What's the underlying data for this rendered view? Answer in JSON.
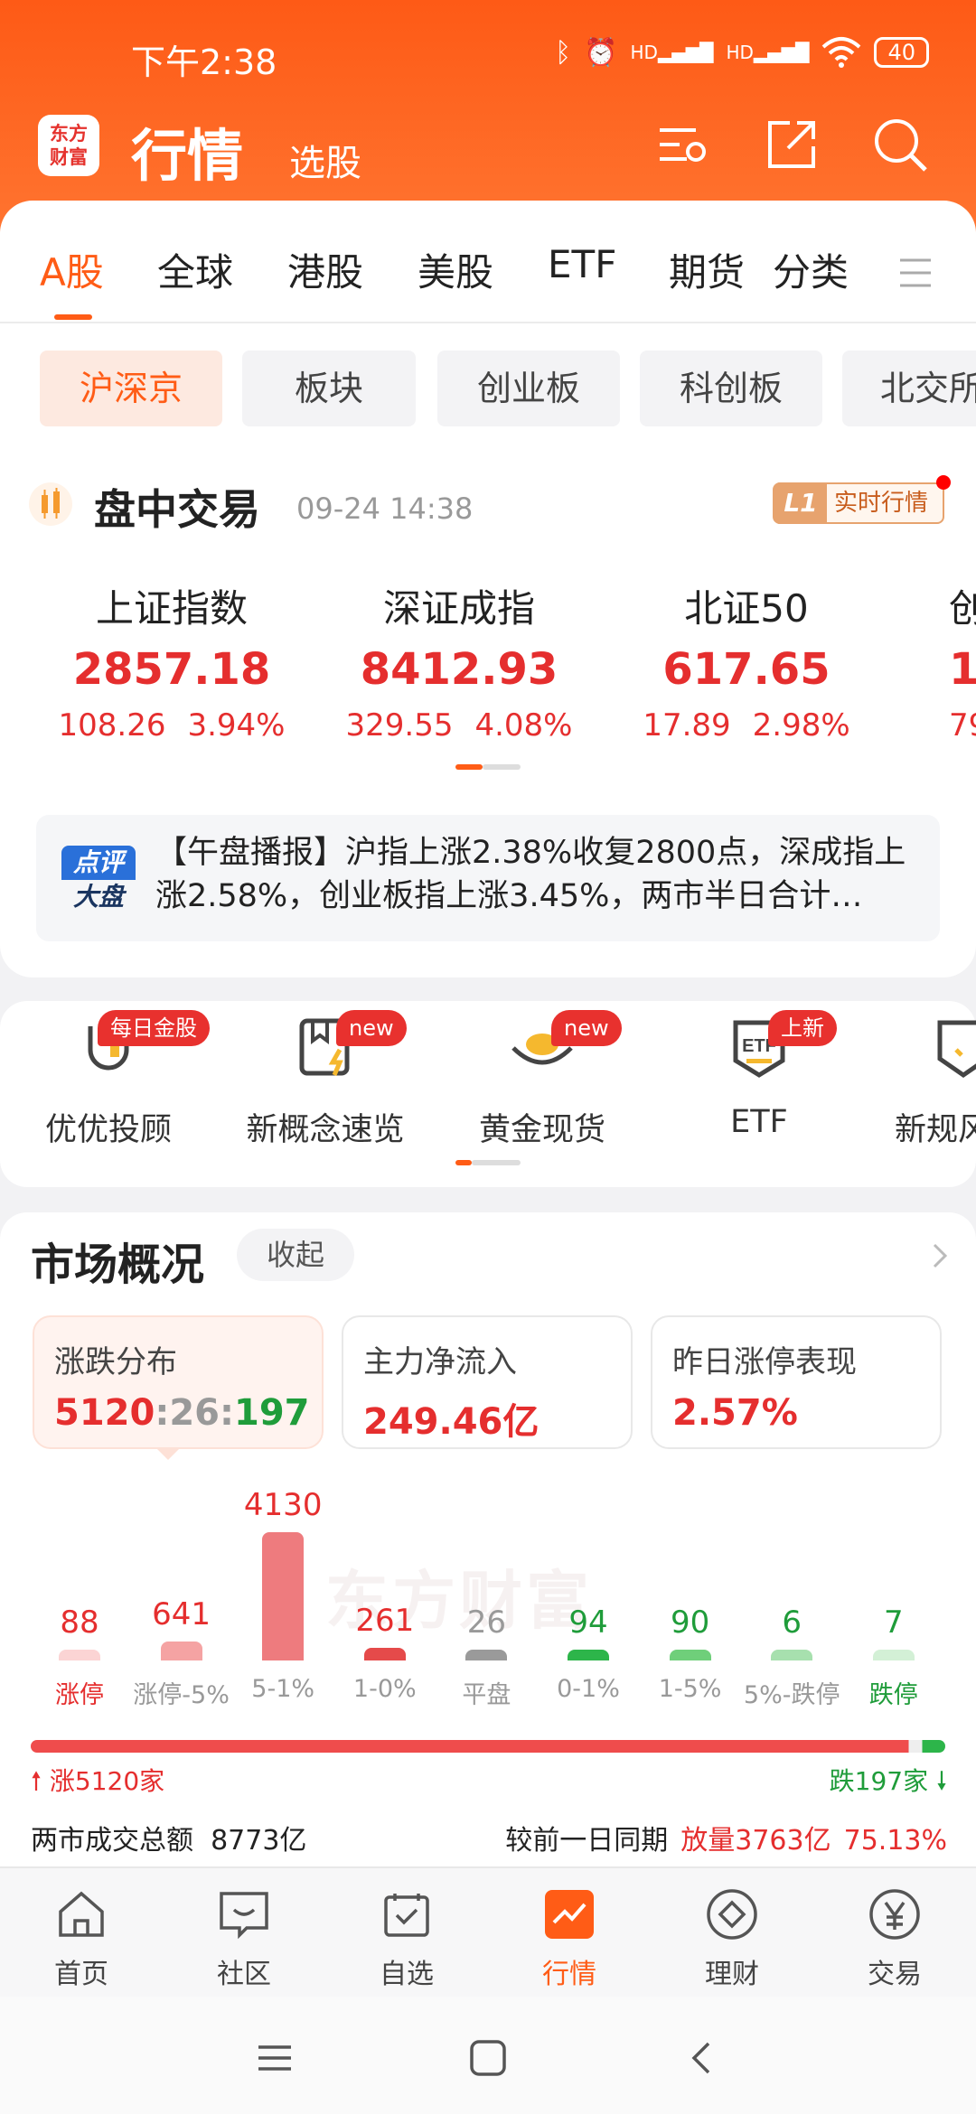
{
  "status_bar": {
    "time": "下午2:38",
    "bluetooth": "ᛒ",
    "alarm": "⏰",
    "signal1": "HD",
    "signal2": "HD",
    "battery": "40"
  },
  "header": {
    "logo_line1": "东方",
    "logo_line2": "财富",
    "title": "行情",
    "subtitle": "选股"
  },
  "market_tabs": [
    "A股",
    "全球",
    "港股",
    "美股",
    "ETF",
    "期货",
    "分类"
  ],
  "sub_tabs": [
    "沪深京",
    "板块",
    "创业板",
    "科创板",
    "北交所"
  ],
  "session": {
    "title": "盘中交易",
    "time": "09-24 14:38",
    "badge_code": "L1",
    "badge_label": "实时行情"
  },
  "indices": [
    {
      "name": "上证指数",
      "value": "2857.18",
      "change": "108.26",
      "pct": "3.94%"
    },
    {
      "name": "深证成指",
      "value": "8412.93",
      "change": "329.55",
      "pct": "4.08%"
    },
    {
      "name": "北证50",
      "value": "617.65",
      "change": "17.89",
      "pct": "2.98%"
    },
    {
      "name": "创",
      "value": "1",
      "change": "79",
      "pct": ""
    }
  ],
  "news": {
    "badge_top": "点评",
    "badge_bottom": "大盘",
    "text": "【午盘播报】沪指上涨2.38%收复2800点，深成指上涨2.58%，创业板指上涨3.45%，两市半日合计…"
  },
  "entries": [
    {
      "label": "优优投顾",
      "tag": "每日金股"
    },
    {
      "label": "新概念速览",
      "tag": "new"
    },
    {
      "label": "黄金现货",
      "tag": "new"
    },
    {
      "label": "ETF",
      "tag": "上新",
      "icon_text": "ETF"
    },
    {
      "label": "新规风",
      "tag": ""
    }
  ],
  "market_overview": {
    "title": "市场概况",
    "collapse_label": "收起",
    "cards": [
      {
        "label": "涨跌分布",
        "up": "5120",
        "sep1": ":",
        "flat": "26",
        "sep2": ":",
        "down": "197"
      },
      {
        "label": "主力净流入",
        "value": "249.46亿"
      },
      {
        "label": "昨日涨停表现",
        "value": "2.57%"
      }
    ],
    "watermark": "东方财富",
    "ratio_left": "涨5120家",
    "ratio_right": "跌197家",
    "turnover_label": "两市成交总额",
    "turnover_value": "8773亿",
    "compare_label": "较前一日同期",
    "compare_value": "放量3763亿",
    "compare_pct": "75.13%"
  },
  "chart_data": {
    "type": "bar",
    "categories": [
      "涨停",
      "涨停-5%",
      "5-1%",
      "1-0%",
      "平盘",
      "0-1%",
      "1-5%",
      "5%-跌停",
      "跌停"
    ],
    "values": [
      88,
      641,
      4130,
      261,
      26,
      94,
      90,
      6,
      7
    ],
    "colors": [
      "#fbd4d4",
      "#f5a3a3",
      "#ee7b7e",
      "#e54a4a",
      "#9a9a9a",
      "#2db54a",
      "#6fcf7a",
      "#a7e0ae",
      "#d3f0d6"
    ],
    "value_colors": [
      "#e52e2e",
      "#e52e2e",
      "#e52e2e",
      "#e52e2e",
      "#999999",
      "#1f9c3a",
      "#1f9c3a",
      "#1f9c3a",
      "#1f9c3a"
    ]
  },
  "bottom_tabs": [
    "首页",
    "社区",
    "自选",
    "行情",
    "理财",
    "交易"
  ]
}
